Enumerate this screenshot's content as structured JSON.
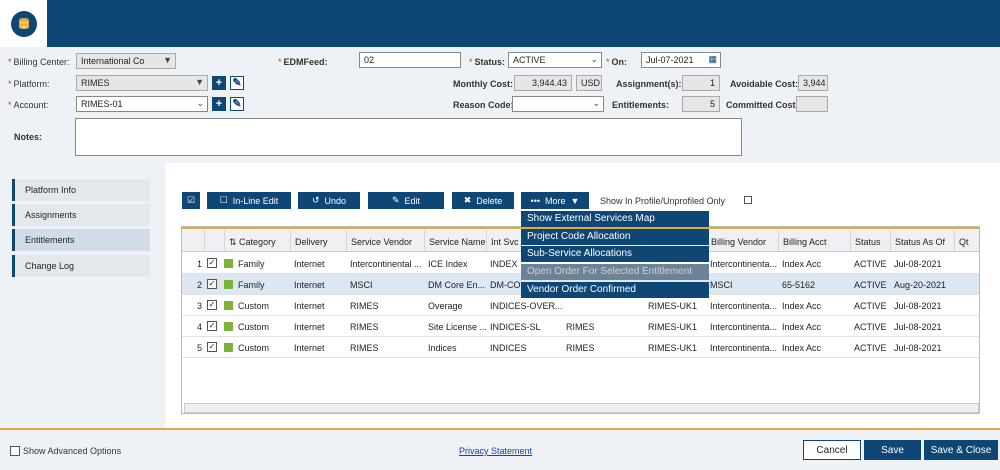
{
  "form": {
    "billing_center": {
      "label": "Billing Center:",
      "value": "International Co"
    },
    "platform": {
      "label": "Platform:",
      "value": "RIMES"
    },
    "account": {
      "label": "Account:",
      "value": "RIMES-01"
    },
    "edmfeed": {
      "label": "EDMFeed:",
      "value": "02"
    },
    "status": {
      "label": "Status:",
      "value": "ACTIVE"
    },
    "on": {
      "label": "On:",
      "value": "Jul-07-2021"
    },
    "monthly_cost": {
      "label": "Monthly Cost:",
      "value": "3,944.43",
      "currency": "USD"
    },
    "assignments": {
      "label": "Assignment(s):",
      "value": "1"
    },
    "avoidable_cost": {
      "label": "Avoidable Cost:",
      "value": "3,944"
    },
    "reason_code": {
      "label": "Reason Code:",
      "value": ""
    },
    "entitlements": {
      "label": "Entitlements:",
      "value": "5"
    },
    "committed_cost": {
      "label": "Committed Cost:",
      "value": ""
    },
    "notes": {
      "label": "Notes:",
      "value": ""
    }
  },
  "sidebar": {
    "items": [
      {
        "label": "Platform Info"
      },
      {
        "label": "Assignments"
      },
      {
        "label": "Entitlements"
      },
      {
        "label": "Change Log"
      }
    ]
  },
  "toolbar": {
    "inline_edit": "In-Line Edit",
    "undo": "Undo",
    "edit": "Edit",
    "delete": "Delete",
    "more": "More",
    "profile_filter": "Show In Profile/Unprofiled Only"
  },
  "more_menu": [
    {
      "label": "Show External Services Map"
    },
    {
      "label": "Project Code Allocation"
    },
    {
      "label": "Sub-Service Allocations"
    },
    {
      "label": "Open Order For Selected Entitlement"
    },
    {
      "label": "Vendor Order Confirmed"
    }
  ],
  "table": {
    "columns": [
      "Category",
      "Delivery",
      "Service Vendor",
      "Service Name",
      "Int Svc I",
      "Billing Vendor",
      "Billing Acct",
      "Status",
      "Status As Of",
      "Qt"
    ],
    "rows": [
      {
        "n": "1",
        "check": "✓",
        "category": "Family",
        "delivery": "Internet",
        "service_vendor": "Intercontinental ...",
        "service_name": "ICE Index",
        "int_svc": "INDEX",
        "billing_vendor": "Intercontinenta...",
        "billing_acct": "Index Acc",
        "status": "ACTIVE",
        "status_as_of": "Jul-08-2021"
      },
      {
        "n": "2",
        "check": "✓",
        "category": "Family",
        "delivery": "Internet",
        "service_vendor": "MSCI",
        "service_name": "DM Core En...",
        "int_svc": "DM-CO",
        "billing_vendor": "MSCI",
        "billing_acct": "65-5162",
        "status": "ACTIVE",
        "status_as_of": "Aug-20-2021"
      },
      {
        "n": "3",
        "check": "✓",
        "category": "Custom",
        "delivery": "Internet",
        "service_vendor": "RIMES",
        "service_name": "Overage",
        "int_svc": "INDICES-OVER...",
        "col7": "RIMES-UK1",
        "billing_vendor": "Intercontinenta...",
        "billing_acct": "Index Acc",
        "status": "ACTIVE",
        "status_as_of": "Jul-08-2021"
      },
      {
        "n": "4",
        "check": "✓",
        "category": "Custom",
        "delivery": "Internet",
        "service_vendor": "RIMES",
        "service_name": "Site License ...",
        "int_svc": "INDICES-SL",
        "col6": "RIMES",
        "col7": "RIMES-UK1",
        "billing_vendor": "Intercontinenta...",
        "billing_acct": "Index Acc",
        "status": "ACTIVE",
        "status_as_of": "Jul-08-2021"
      },
      {
        "n": "5",
        "check": "✓",
        "category": "Custom",
        "delivery": "Internet",
        "service_vendor": "RIMES",
        "service_name": "Indices",
        "int_svc": "INDICES",
        "col6": "RIMES",
        "col7": "RIMES-UK1",
        "billing_vendor": "Intercontinenta...",
        "billing_acct": "Index Acc",
        "status": "ACTIVE",
        "status_as_of": "Jul-08-2021"
      }
    ]
  },
  "footer": {
    "show_advanced": "Show Advanced Options",
    "privacy": "Privacy Statement",
    "cancel": "Cancel",
    "save": "Save",
    "save_close": "Save & Close"
  },
  "colors": {
    "brand": "#0e4675",
    "accent": "#e8a93a",
    "category_swatch": "#7db33a"
  }
}
